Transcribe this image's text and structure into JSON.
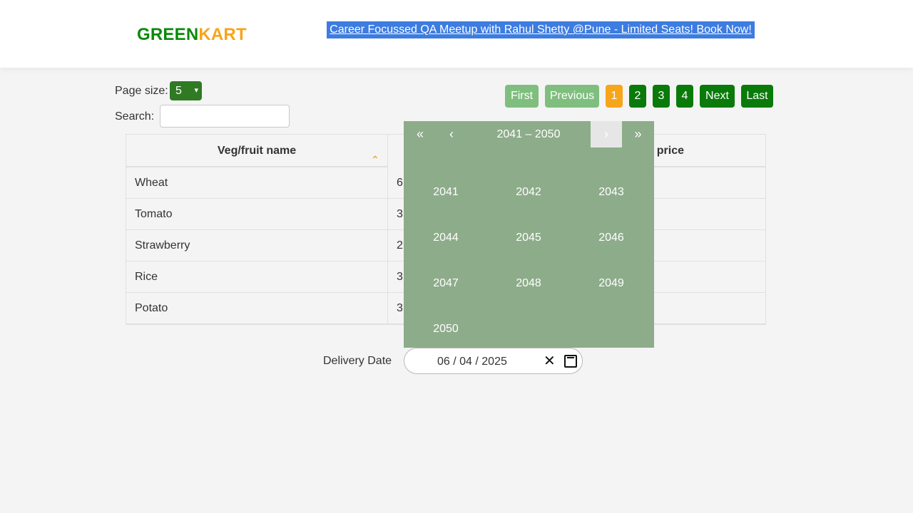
{
  "header": {
    "brand_green": "GREEN",
    "brand_kart": "KART",
    "promo": "Career Focussed QA Meetup with Rahul Shetty @Pune - Limited Seats! Book Now!"
  },
  "controls": {
    "page_size_label": "Page size:",
    "page_size_value": "5",
    "search_label": "Search:",
    "search_value": ""
  },
  "pagination": {
    "first": "First",
    "previous": "Previous",
    "pages": [
      "1",
      "2",
      "3",
      "4"
    ],
    "active_page": "1",
    "next": "Next",
    "last": "Last"
  },
  "table": {
    "headers": [
      "Veg/fruit name",
      "t price"
    ],
    "rows": [
      {
        "name": "Wheat",
        "partial": "6"
      },
      {
        "name": "Tomato",
        "partial": "3"
      },
      {
        "name": "Strawberry",
        "partial": "2"
      },
      {
        "name": "Rice",
        "partial": "3"
      },
      {
        "name": "Potato",
        "partial": "3"
      }
    ]
  },
  "delivery": {
    "label": "Delivery Date",
    "date": "06 / 04 / 2025",
    "clear_icon": "close-icon",
    "calendar_icon": "calendar-icon"
  },
  "calendar": {
    "prev_double": "«",
    "prev": "‹",
    "decade": "2041 – 2050",
    "next": "›",
    "next_double": "»",
    "years": [
      "2041",
      "2042",
      "2043",
      "2044",
      "2045",
      "2046",
      "2047",
      "2048",
      "2049",
      "2050"
    ]
  },
  "colors": {
    "brand_green": "#0a8a0a",
    "brand_orange": "#f7a51b",
    "promo_bg": "#3d7ce0",
    "calendar_bg": "#8dac8a"
  }
}
